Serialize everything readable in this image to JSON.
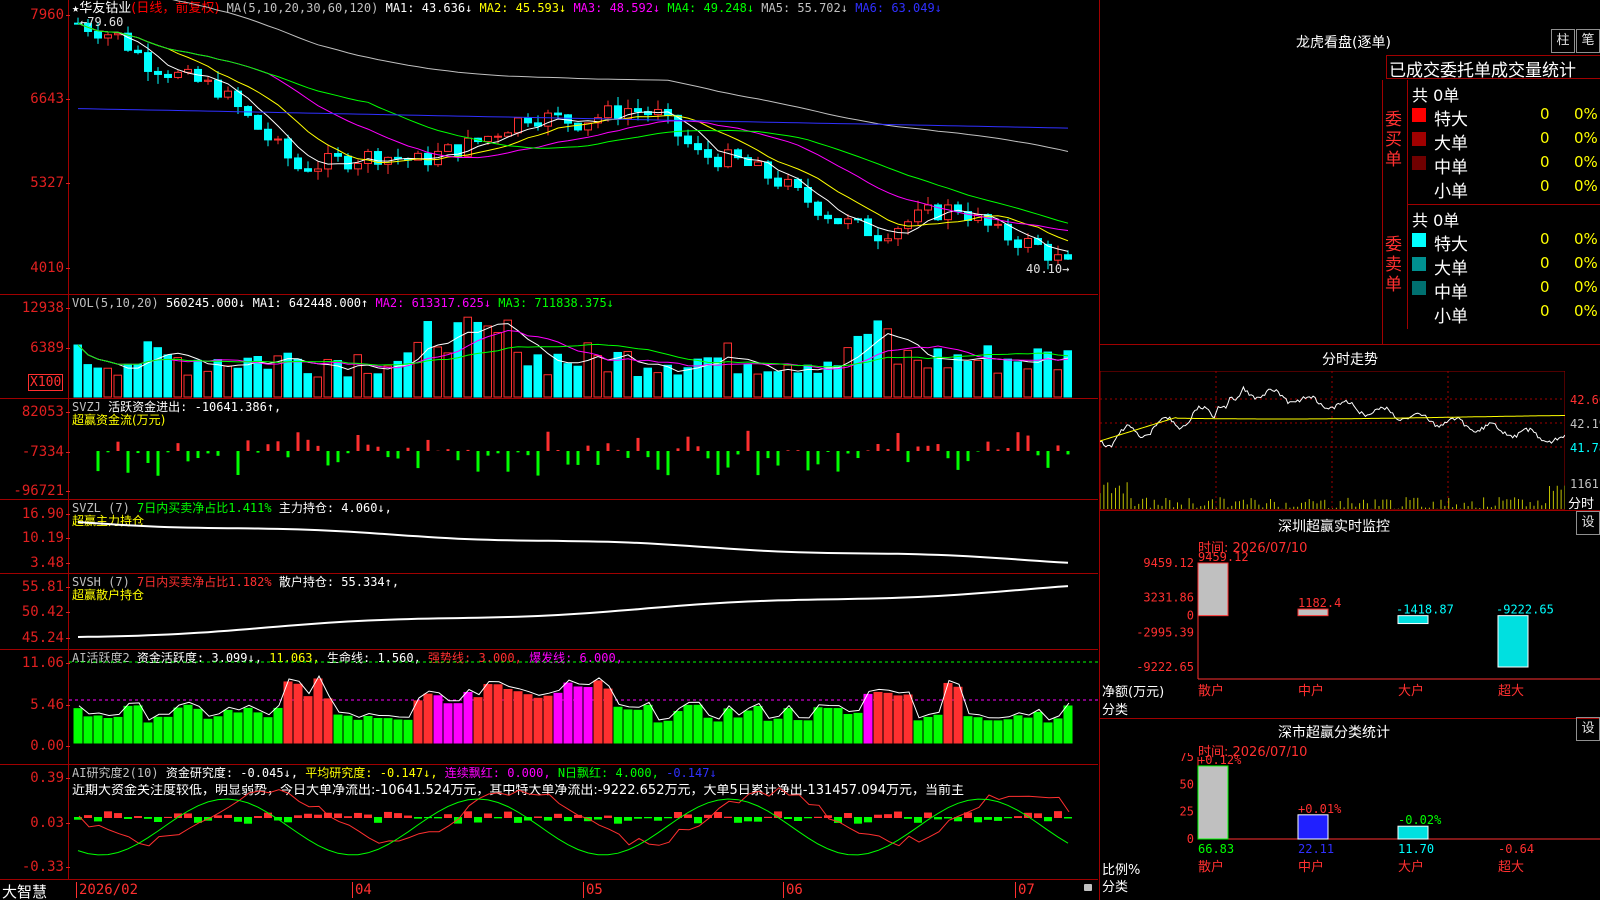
{
  "header": {
    "star": "★",
    "stock": "华友钴业",
    "mode": "(日线，前复权)",
    "ma_label": "MA(5,10,20,30,60,120)",
    "ma": [
      {
        "t": "MA1: 43.636↓",
        "c": "#ffffff"
      },
      {
        "t": "MA2: 45.593↓",
        "c": "#ffff00"
      },
      {
        "t": "MA3: 48.592↓",
        "c": "#ff00ff"
      },
      {
        "t": "MA4: 49.248↓",
        "c": "#00ff00"
      },
      {
        "t": "MA5: 55.702↓",
        "c": "#c0c0c0"
      },
      {
        "t": "MA6: 63.049↓",
        "c": "#3030ff"
      }
    ],
    "high_note": "79.60",
    "low_note": "40.10"
  },
  "price_axis": [
    "7960",
    "6643",
    "5327",
    "4010"
  ],
  "vol": {
    "label": "VOL(5,10,20)",
    "value": "560245.000↓",
    "ma": [
      {
        "t": "MA1: 642448.000↑",
        "c": "#ffffff"
      },
      {
        "t": "MA2: 613317.625↓",
        "c": "#ff00ff"
      },
      {
        "t": "MA3: 711838.375↓",
        "c": "#00ff00"
      }
    ],
    "axis": [
      "12938",
      "6389"
    ],
    "unit": "X100"
  },
  "svzj": {
    "label": "SVZJ",
    "text": "活跃资金进出: -10641.386↑,",
    "sub": "超赢资金流(万元)",
    "axis": [
      "82053",
      "-7334",
      "-96721"
    ]
  },
  "svzl": {
    "label": "SVZL (7)",
    "t1": "7日内买卖净占比1.411%",
    "t2": "主力持仓: 4.060↓,",
    "sub": "超赢主力持仓",
    "axis": [
      "16.90",
      "10.19",
      "3.48"
    ]
  },
  "svsh": {
    "label": "SVSH (7)",
    "t1": "7日内买卖净占比1.182%",
    "t2": "散户持仓: 55.334↑,",
    "sub": "超赢散户持仓",
    "axis": [
      "55.81",
      "50.42",
      "45.24"
    ]
  },
  "ai2": {
    "label": "AI活跃度2",
    "t1": "资金活跃度: 3.099↓,",
    "t2": "11.063,",
    "t3": "生命线: 1.560,",
    "t4": "强势线: 3.000,",
    "t5": "爆发线: 6.000,",
    "axis": [
      "11.06",
      "5.46",
      "0.00"
    ]
  },
  "air": {
    "label": "AI研究度2(10)",
    "t1": "资金研究度: -0.045↓,",
    "t2": "平均研究度: -0.147↓,",
    "t3": "连续飘红: 0.000,",
    "t4": "N日飘红: 4.000,",
    "t5": "-0.147↓",
    "note": "近期大资金关注度较低，明显弱势，今日大单净流出:-10641.524万元，其中特大单净流出:-9222.652万元，大单5日累计净出-131457.094万元，当前主",
    "axis": [
      "0.39",
      "0.03",
      "-0.33"
    ]
  },
  "footer": {
    "brand": "大智慧",
    "dates": [
      "2026/02",
      "04",
      "05",
      "06",
      "07"
    ]
  },
  "longhu": {
    "title": "龙虎看盘(逐单)",
    "btn1": "柱",
    "btn2": "笔",
    "tabs": "已成交委托单成交量统计",
    "buy_side": "委买单",
    "sell_side": "委卖单",
    "buy_total": "共 0单",
    "sell_total": "共 0单",
    "buy": [
      {
        "n": "特大",
        "v": "0",
        "p": "0%",
        "c": "#ff0000"
      },
      {
        "n": "大单",
        "v": "0",
        "p": "0%",
        "c": "#a00000"
      },
      {
        "n": "中单",
        "v": "0",
        "p": "0%",
        "c": "#700000"
      },
      {
        "n": "小单",
        "v": "0",
        "p": "0%",
        "c": "#000000"
      }
    ],
    "sell": [
      {
        "n": "特大",
        "v": "0",
        "p": "0%",
        "c": "#00ffff"
      },
      {
        "n": "大单",
        "v": "0",
        "p": "0%",
        "c": "#009090"
      },
      {
        "n": "中单",
        "v": "0",
        "p": "0%",
        "c": "#007070"
      },
      {
        "n": "小单",
        "v": "0",
        "p": "0%",
        "c": "#000000"
      }
    ]
  },
  "intraday": {
    "title": "分时走势",
    "axis": [
      "42.60",
      "42.19",
      "41.78"
    ],
    "vol_axis": "1161",
    "unit": "分时"
  },
  "szmonitor": {
    "title": "深圳超赢实时监控",
    "btn": "设",
    "time": "时间: 2026/07/10",
    "axis": [
      "9459.12",
      "3231.86",
      "0",
      "-2995.39",
      "-9222.65"
    ],
    "ylab": "净额(万元)",
    "xlab": "分类",
    "bars": [
      {
        "cat": "散户",
        "v": 9459.12,
        "label": "9459.12"
      },
      {
        "cat": "中户",
        "v": 1182.4,
        "label": "1182.4"
      },
      {
        "cat": "大户",
        "v": -1418.87,
        "label": "-1418.87"
      },
      {
        "cat": "超大",
        "v": -9222.65,
        "label": "-9222.65"
      }
    ]
  },
  "szstat": {
    "title": "深市超赢分类统计",
    "btn": "设",
    "time": "时间: 2026/07/10",
    "axis": [
      "75",
      "50",
      "25",
      "0"
    ],
    "ylab": "比例%",
    "xlab": "分类",
    "bars": [
      {
        "cat": "散户",
        "v": 66.83,
        "chg": "+0.12%"
      },
      {
        "cat": "中户",
        "v": 22.11,
        "chg": "+0.01%"
      },
      {
        "cat": "大户",
        "v": 11.7,
        "chg": "-0.02%"
      },
      {
        "cat": "超大",
        "v": -0.64,
        "chg": ""
      }
    ]
  }
}
